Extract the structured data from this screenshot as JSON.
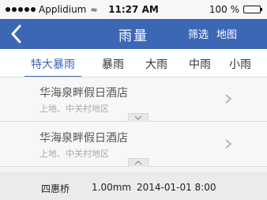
{
  "statusbar": {
    "carrier": "Applidium",
    "time": "11:27 AM",
    "battery": "100 %",
    "battery_level": 1.0
  },
  "navbar": {
    "title": "雨量",
    "filter_label": "筛选",
    "map_label": "地图"
  },
  "tabs": [
    {
      "label": "特大暴雨",
      "active": true
    },
    {
      "label": "暴雨",
      "active": false
    },
    {
      "label": "大雨",
      "active": false
    },
    {
      "label": "中雨",
      "active": false
    },
    {
      "label": "小雨",
      "active": false
    }
  ],
  "cards": [
    {
      "name": "华海泉畔假日酒店",
      "area": "上地、中关村地区",
      "expanded": false
    },
    {
      "name": "华海泉畔假日酒店",
      "area": "上地、中关村地区",
      "expanded": true
    }
  ],
  "detail": {
    "station": "四惠桥",
    "amount": "1.00mm",
    "date": "2014-01-01 8:00"
  }
}
